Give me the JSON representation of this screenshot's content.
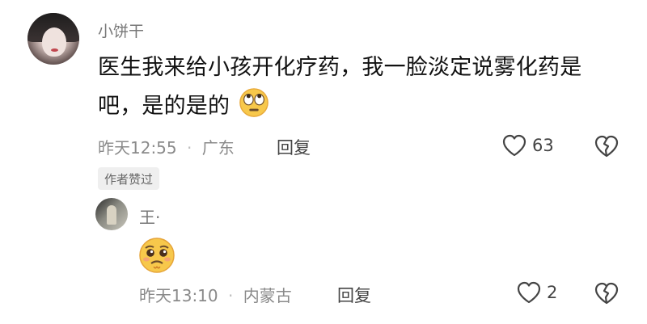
{
  "comment": {
    "username": "小饼干",
    "text_line1": "医生我来给小孩开化疗药，我一脸淡定说雾化药是",
    "text_line2": "吧，是的是的",
    "inline_emoji": "rolling-eyes-emoji",
    "time": "昨天12:55",
    "location": "广东",
    "separator": "·",
    "reply_label": "回复",
    "like_count": "63",
    "author_badge": "作者赞过"
  },
  "reply": {
    "username": "王·",
    "emoji": "pleading-face-emoji",
    "time": "昨天13:10",
    "location": "内蒙古",
    "separator": "·",
    "reply_label": "回复",
    "like_count": "2"
  }
}
